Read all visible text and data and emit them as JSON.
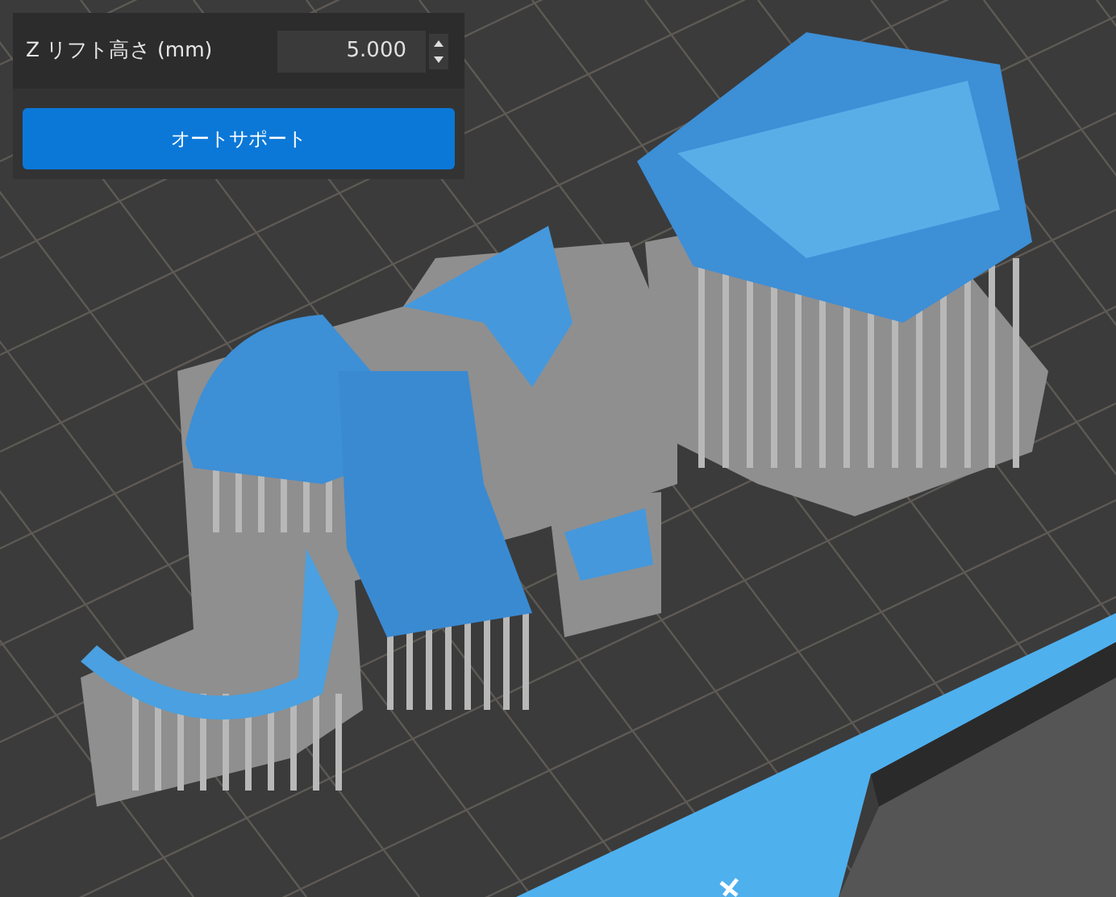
{
  "z_lift": {
    "label": "Z リフト高さ (mm)",
    "value": "5.000"
  },
  "auto_support_button": {
    "label": "オートサポート"
  }
}
